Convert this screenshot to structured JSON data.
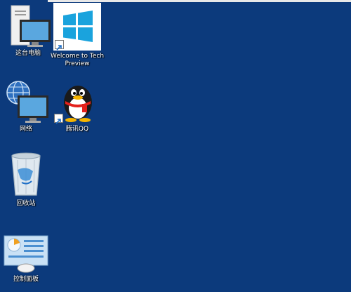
{
  "desktop": {
    "background_color": "#0c3a7c",
    "icons": [
      {
        "label": "这台电脑",
        "icon": "computer-icon"
      },
      {
        "label": "Welcome to Tech Preview",
        "icon": "windows-logo-icon"
      },
      {
        "label": "网络",
        "icon": "network-icon"
      },
      {
        "label": "腾讯QQ",
        "icon": "qq-penguin-icon"
      },
      {
        "label": "回收站",
        "icon": "recycle-bin-icon"
      },
      {
        "label": "控制面板",
        "icon": "control-panel-icon"
      }
    ]
  }
}
